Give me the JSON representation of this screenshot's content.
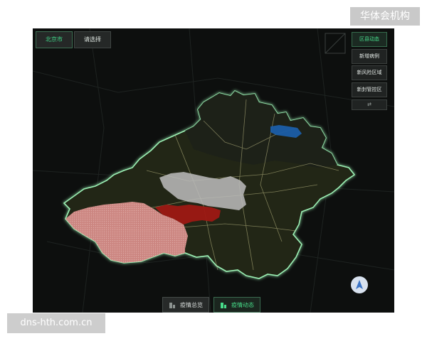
{
  "top_bar": {
    "city_label": "北京市",
    "select_label": "请选择"
  },
  "right_panel": {
    "items": [
      "区县动态",
      "新增病例",
      "新风险区域",
      "新封管控区"
    ],
    "refresh_icon": "swap-arrows-icon"
  },
  "bottom_tabs": [
    {
      "label": "疫情总览",
      "icon": "building-icon",
      "active": false
    },
    {
      "label": "疫情动态",
      "icon": "building-icon",
      "active": true
    }
  ],
  "compass_icon": "navigation-arrow-icon",
  "watermarks": {
    "top_right": "华体会机构",
    "bottom_left": "dns-hth.com.cn"
  },
  "colors": {
    "accent": "#41d98a",
    "boundary": "#9bf0b4",
    "region_pink": "#d98a86",
    "region_red": "#a11a16",
    "region_gray": "#c9c9c9",
    "region_blue": "#1b5ea8"
  }
}
